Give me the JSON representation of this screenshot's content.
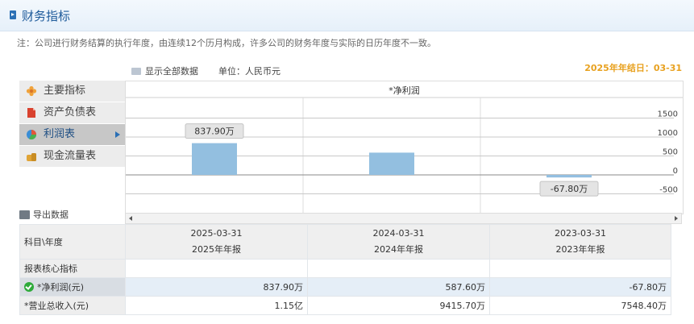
{
  "header": {
    "title": "财务指标"
  },
  "note": "注：公司进行财务结算的执行年度，由连续12个历月构成，许多公司的财务年度与实际的日历年度不一致。",
  "options": {
    "show_all": "显示全部数据",
    "unit": "单位：人民币元"
  },
  "year_end": "2025年年结日：03-31",
  "menu": {
    "items": [
      {
        "label": "主要指标",
        "icon": "flower-icon",
        "color": "#f0a23a"
      },
      {
        "label": "资产负债表",
        "icon": "document-icon",
        "color": "#d9422f"
      },
      {
        "label": "利润表",
        "icon": "pie-chart-icon",
        "color": "#3a8ed6"
      },
      {
        "label": "现金流量表",
        "icon": "money-bag-icon",
        "color": "#e0a436"
      }
    ],
    "active_index": 2
  },
  "export": {
    "label": "导出数据"
  },
  "chart_data": {
    "type": "bar",
    "title": "*净利润",
    "categories": [
      "2025-03-31",
      "2024-03-31",
      "2023-03-31"
    ],
    "values": [
      837.9,
      587.6,
      -67.8
    ],
    "ylim": [
      -1000,
      2000
    ],
    "y_ticks": [
      1500,
      1000,
      500,
      0,
      -500
    ],
    "data_labels": [
      "837.90万",
      "",
      "-67.80万"
    ],
    "bar_color": "#93bfe0",
    "grid": true
  },
  "table": {
    "corner": "科目\\年度",
    "columns": [
      {
        "date": "2025-03-31",
        "period": "2025年年报"
      },
      {
        "date": "2024-03-31",
        "period": "2024年年报"
      },
      {
        "date": "2023-03-31",
        "period": "2023年年报"
      }
    ],
    "section": "报表核心指标",
    "rows": [
      {
        "label": "*净利润(元)",
        "values": [
          "837.90万",
          "587.60万",
          "-67.80万"
        ]
      },
      {
        "label": "*营业总收入(元)",
        "values": [
          "1.15亿",
          "9415.70万",
          "7548.40万"
        ]
      }
    ]
  }
}
